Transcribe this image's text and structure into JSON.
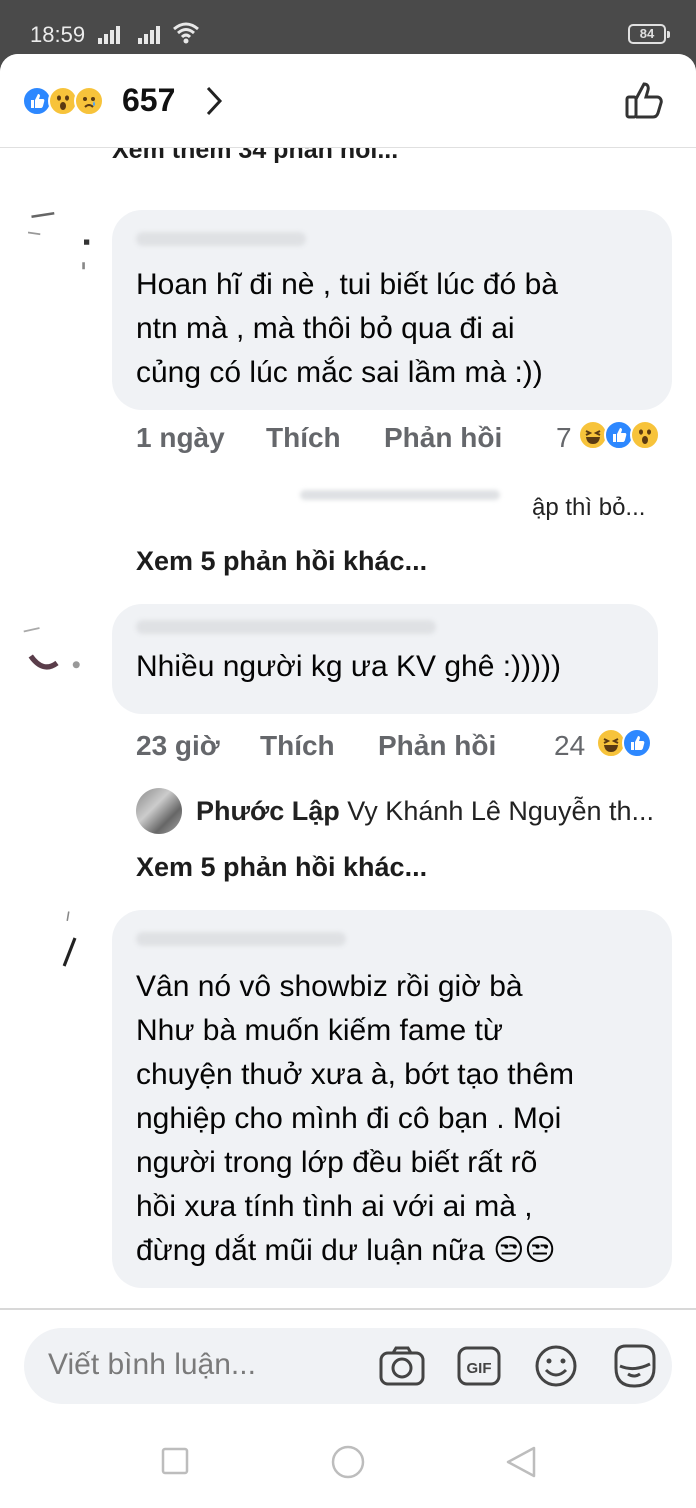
{
  "status": {
    "time": "18:59",
    "battery": "84"
  },
  "header": {
    "reaction_count": "657",
    "reaction_icons": [
      "like-icon",
      "wow-icon",
      "sad-icon"
    ]
  },
  "older_replies": "Xem thêm 34 phản hồi...",
  "comments": [
    {
      "lines": [
        "Hoan hĩ đi nè , tui biết lúc đó bà",
        "ntn mà , mà thôi bỏ qua đi ai",
        "củng có lúc mắc sai lầm mà :))"
      ],
      "time": "1 ngày",
      "like": "Thích",
      "reply": "Phản hồi",
      "reaction_count": "7",
      "reactions": [
        "haha-icon",
        "like-icon",
        "wow-icon"
      ]
    },
    {
      "lines": [
        "Nhiều người kg ưa KV ghê :)))))"
      ],
      "time": "23 giờ",
      "like": "Thích",
      "reply": "Phản hồi",
      "reaction_count": "24",
      "reactions": [
        "haha-icon",
        "like-icon"
      ]
    },
    {
      "lines": [
        "Vân nó vô showbiz rồi giờ bà",
        "Như bà muốn kiếm fame từ",
        "chuyện thuở xưa à, bớt tạo thêm",
        "nghiệp cho mình đi cô bạn . Mọi",
        "người trong lớp đều biết rất rõ",
        "hồi xưa tính tình ai với ai mà ,",
        "đừng dắt mũi dư luận nữa 😒😒"
      ],
      "time": "",
      "like": "",
      "reply": "",
      "reaction_count": ""
    }
  ],
  "reply_preview_1": "ập thì bỏ...",
  "more_replies_1": "Xem 5 phản hồi khác...",
  "sub_reply": {
    "name": "Phước Lập",
    "text": "Vy Khánh Lê Nguyễn th..."
  },
  "more_replies_2": "Xem 5 phản hồi khác...",
  "composer": {
    "placeholder": "Viết bình luận..."
  }
}
